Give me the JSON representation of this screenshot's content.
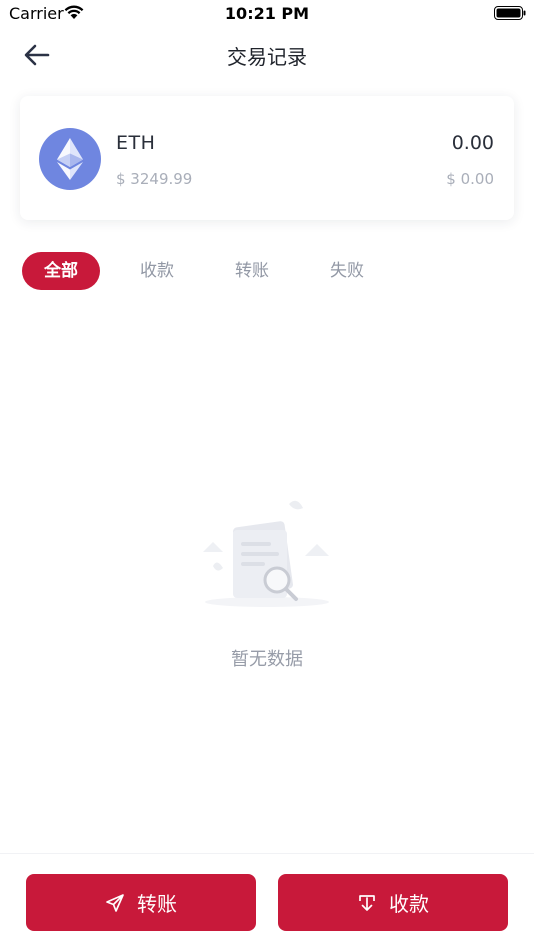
{
  "status_bar": {
    "carrier": "Carrier",
    "time": "10:21 PM"
  },
  "nav": {
    "title": "交易记录",
    "back_icon": "arrow-left-icon"
  },
  "asset": {
    "symbol": "ETH",
    "fiat_price": "$ 3249.99",
    "balance": "0.00",
    "balance_fiat": "$ 0.00",
    "logo_icon": "ethereum-icon",
    "logo_color": "#6f86e0"
  },
  "tabs": [
    {
      "label": "全部",
      "active": true
    },
    {
      "label": "收款",
      "active": false
    },
    {
      "label": "转账",
      "active": false
    },
    {
      "label": "失败",
      "active": false
    }
  ],
  "empty_state": {
    "text": "暂无数据",
    "icon": "empty-document-search-icon"
  },
  "actions": {
    "transfer_label": "转账",
    "transfer_icon": "paper-plane-icon",
    "receive_label": "收款",
    "receive_icon": "download-icon"
  },
  "colors": {
    "accent": "#c8193a",
    "muted_text": "#9298a5"
  }
}
